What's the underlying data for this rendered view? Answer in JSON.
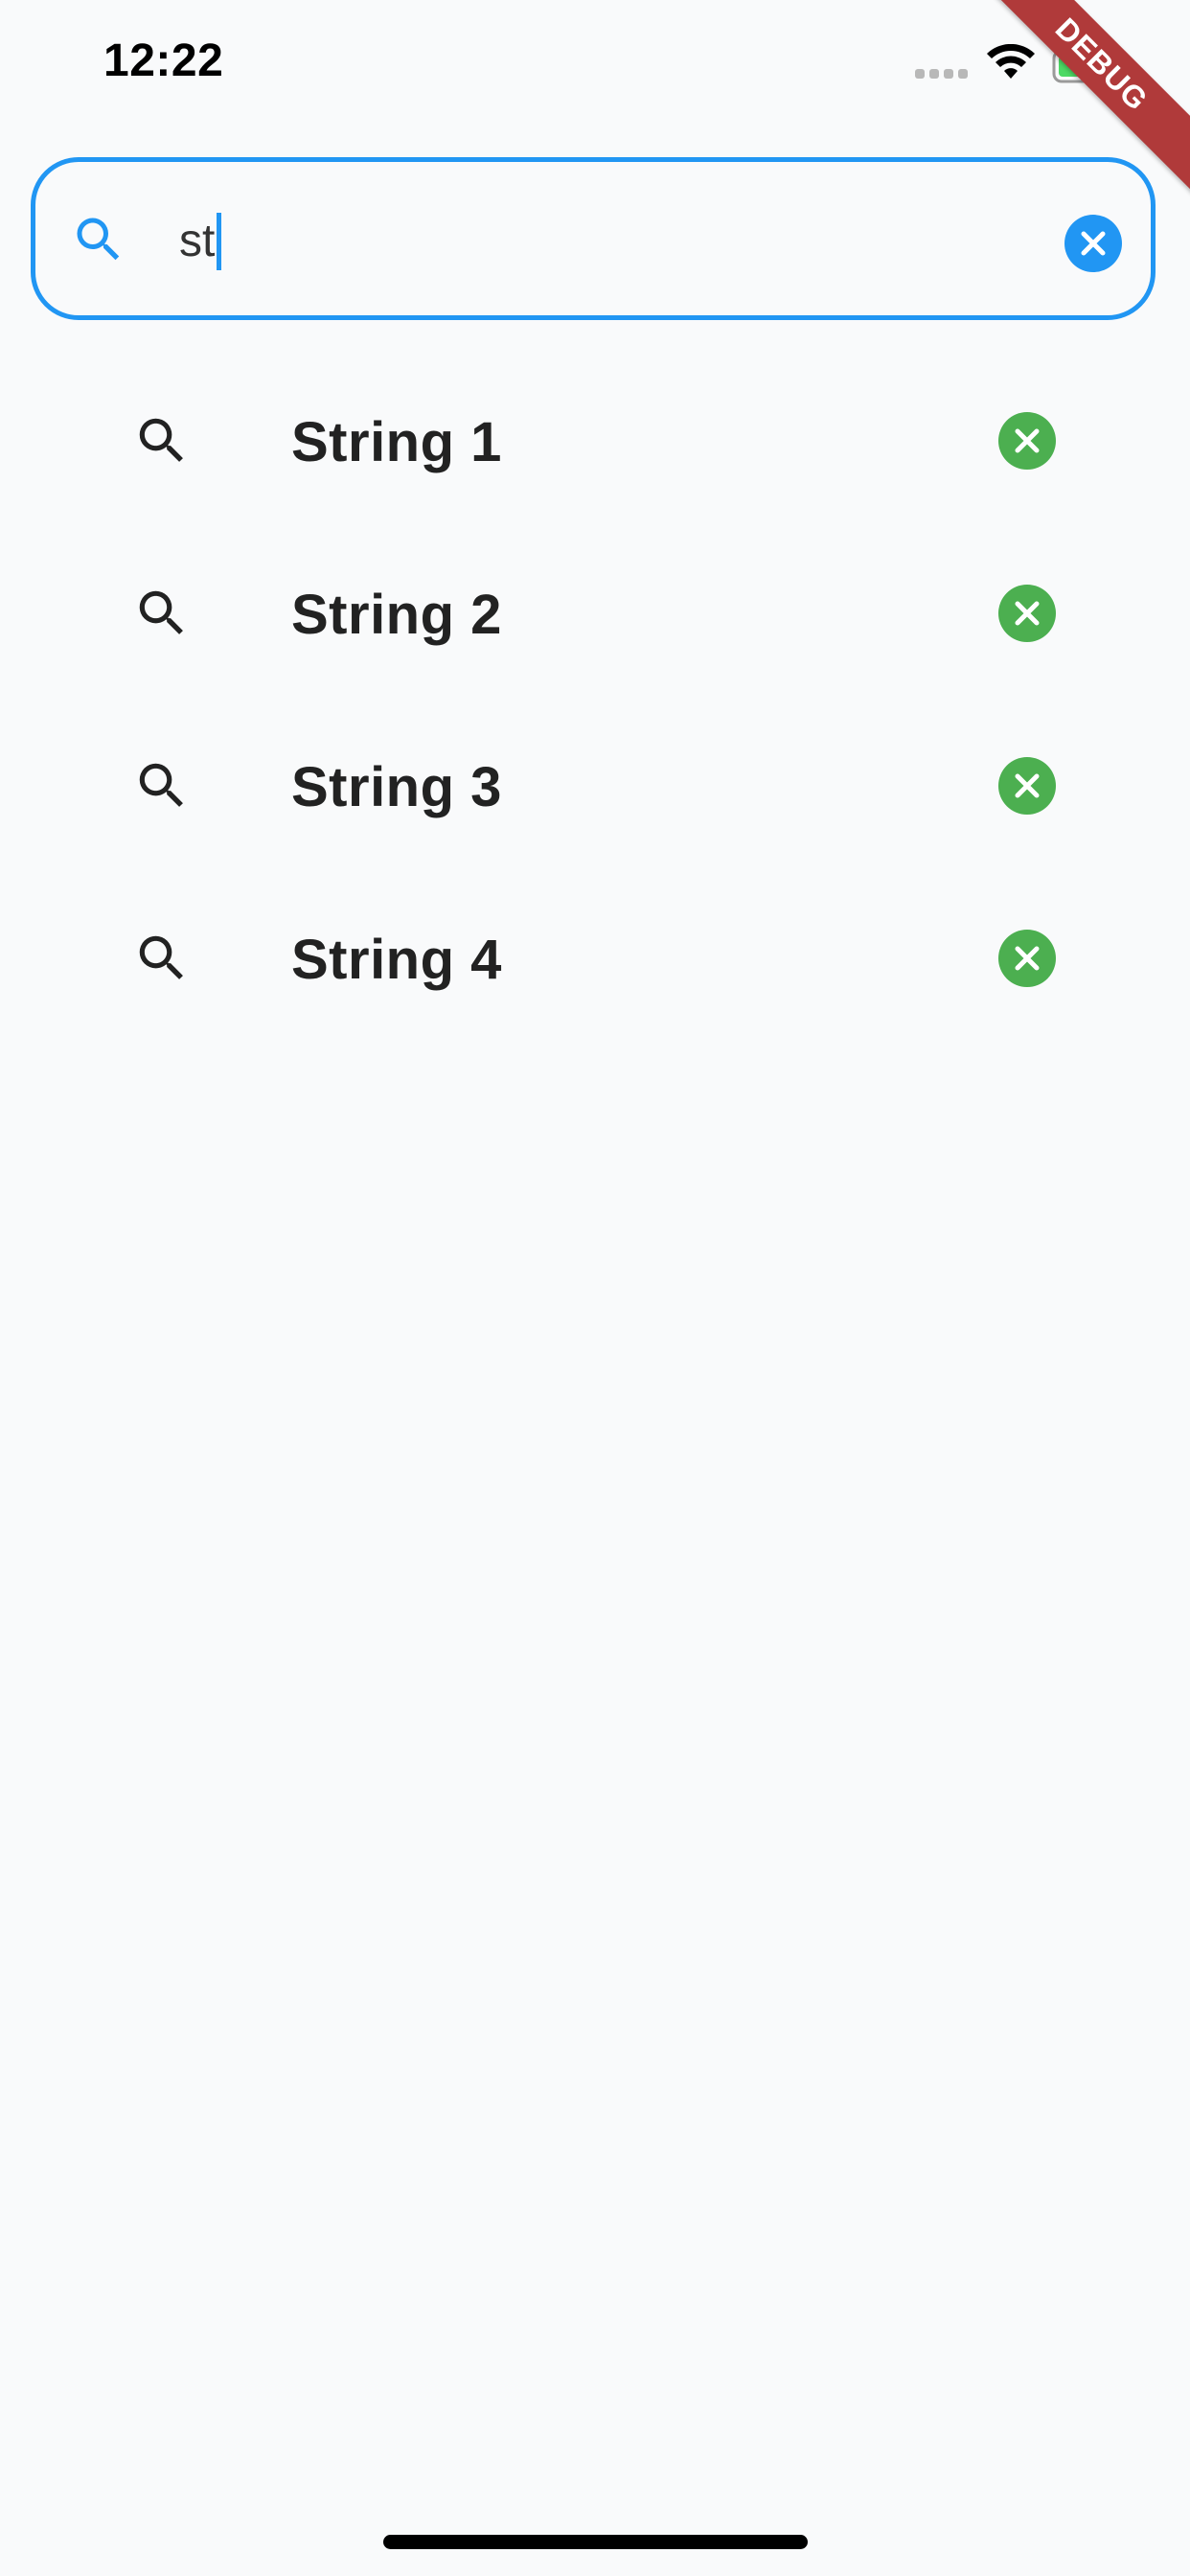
{
  "status_bar": {
    "time": "12:22"
  },
  "debug_banner": {
    "label": "DEBUG",
    "color": "#b03a3a"
  },
  "search": {
    "value": "st",
    "icon": "search-icon",
    "clear_icon": "close-circle-icon",
    "accent_color": "#2196f3"
  },
  "results": {
    "items": [
      {
        "label": "String 1",
        "icon": "search-icon",
        "remove_icon": "close-circle-icon"
      },
      {
        "label": "String 2",
        "icon": "search-icon",
        "remove_icon": "close-circle-icon"
      },
      {
        "label": "String 3",
        "icon": "search-icon",
        "remove_icon": "close-circle-icon"
      },
      {
        "label": "String 4",
        "icon": "search-icon",
        "remove_icon": "close-circle-icon"
      }
    ],
    "remove_color": "#4caf50"
  }
}
